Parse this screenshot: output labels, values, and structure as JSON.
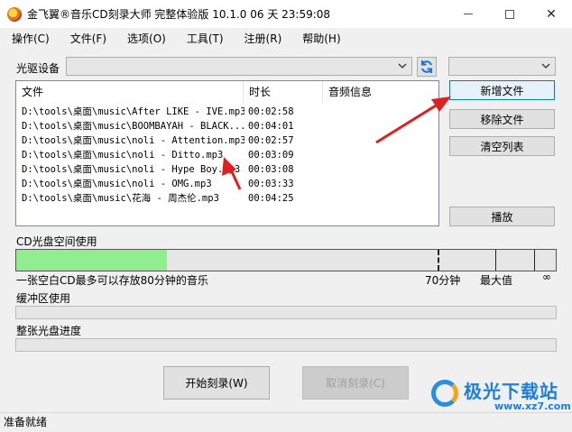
{
  "window": {
    "title": "金飞翼®音乐CD刻录大师 完整体验版 10.1.0 06 天 23:59:08",
    "close_glyph": "✕"
  },
  "menu": [
    "操作(C)",
    "文件(F)",
    "选项(O)",
    "工具(T)",
    "注册(R)",
    "帮助(H)"
  ],
  "drive": {
    "label": "光驱设备",
    "value": "",
    "speed_value": ""
  },
  "filelist": {
    "columns": [
      "文件",
      "时长",
      "音频信息"
    ],
    "rows": [
      {
        "file": "D:\\tools\\桌面\\music\\After LIKE - IVE.mp3",
        "duration": "00:02:58",
        "info": ""
      },
      {
        "file": "D:\\tools\\桌面\\music\\BOOMBAYAH - BLACK...",
        "duration": "00:04:01",
        "info": ""
      },
      {
        "file": "D:\\tools\\桌面\\music\\noli - Attention.mp3",
        "duration": "00:02:57",
        "info": ""
      },
      {
        "file": "D:\\tools\\桌面\\music\\noli - Ditto.mp3",
        "duration": "00:03:09",
        "info": ""
      },
      {
        "file": "D:\\tools\\桌面\\music\\noli - Hype Boy.mp3",
        "duration": "00:03:08",
        "info": ""
      },
      {
        "file": "D:\\tools\\桌面\\music\\noli - OMG.mp3",
        "duration": "00:03:33",
        "info": ""
      },
      {
        "file": "D:\\tools\\桌面\\music\\花海 - 周杰伦.mp3",
        "duration": "00:04:25",
        "info": ""
      }
    ]
  },
  "buttons": {
    "add_file": "新增文件",
    "remove_file": "移除文件",
    "clear_list": "清空列表",
    "play": "播放",
    "start_burn": "开始刻录(W)",
    "cancel_burn": "取消刻录(C)"
  },
  "cd_space": {
    "label": "CD光盘空间使用",
    "used_fraction": 0.28,
    "note": "一张空白CD最多可以存放80分钟的音乐",
    "mark_70_label": "70分钟",
    "max_label": "最大值",
    "infinity_label": "∞"
  },
  "buffer": {
    "label": "缓冲区使用",
    "fraction": 0
  },
  "disc_progress": {
    "label": "整张光盘进度",
    "fraction": 0
  },
  "status": {
    "text": "准备就绪"
  },
  "watermark": {
    "text": "极光下载站",
    "url": "www.xz7.com"
  },
  "colors": {
    "cd_fill": "#90ee90",
    "annotation_arrow": "#e02020",
    "accent": "#0078d7"
  }
}
